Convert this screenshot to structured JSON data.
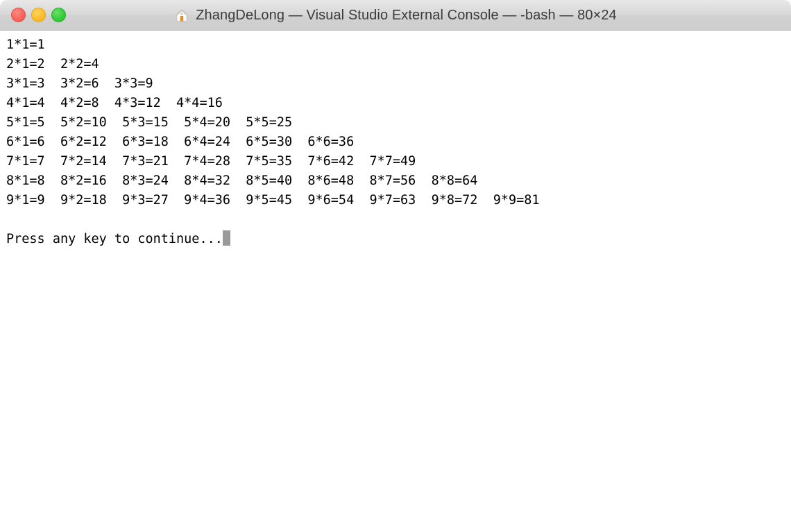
{
  "window": {
    "title": "ZhangDeLong — Visual Studio External Console — -bash — 80×24",
    "icon": "home-icon",
    "size_label": "80×24",
    "controls": {
      "close_label": "Close",
      "minimize_label": "Minimize",
      "zoom_label": "Zoom"
    },
    "colors": {
      "close": "#f9655b",
      "minimize": "#fdbc2c",
      "zoom": "#35cd3a",
      "titlebar_top": "#e8e8e8",
      "titlebar_bottom": "#cdcdcd",
      "title_text": "#3b3b3b",
      "terminal_bg": "#ffffff",
      "terminal_fg": "#000000",
      "cursor": "#9a9a9a"
    }
  },
  "terminal": {
    "lines": [
      "1*1=1",
      "2*1=2  2*2=4",
      "3*1=3  3*2=6  3*3=9",
      "4*1=4  4*2=8  4*3=12  4*4=16",
      "5*1=5  5*2=10  5*3=15  5*4=20  5*5=25",
      "6*1=6  6*2=12  6*3=18  6*4=24  6*5=30  6*6=36",
      "7*1=7  7*2=14  7*3=21  7*4=28  7*5=35  7*6=42  7*7=49",
      "8*1=8  8*2=16  8*3=24  8*4=32  8*5=40  8*6=48  8*7=56  8*8=64",
      "9*1=9  9*2=18  9*3=27  9*4=36  9*5=45  9*6=54  9*7=63  9*8=72  9*9=81",
      "",
      "Press any key to continue..."
    ],
    "prompt_line_index": 10,
    "cursor_visible": true
  }
}
